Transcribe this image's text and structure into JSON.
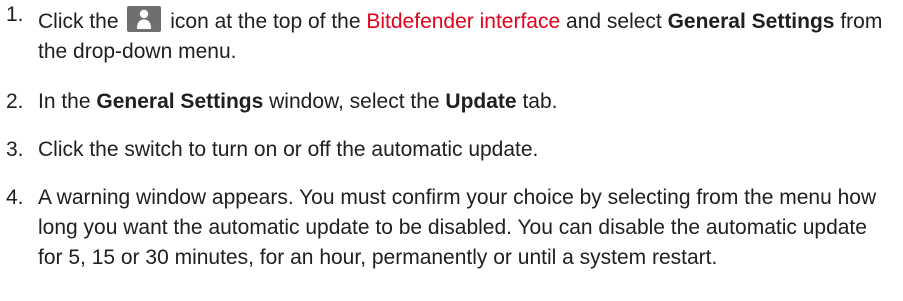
{
  "steps": [
    {
      "number": "1.",
      "text_before_icon": "Click the",
      "icon": "account-icon",
      "text_after_icon": "icon at the top of the",
      "link_text": "Bitdefender interface",
      "text_after_link": "and select",
      "bold_text": "General Settings",
      "text_end": "from the drop-down menu."
    },
    {
      "number": "2.",
      "text_before": "In the",
      "bold_1": "General Settings",
      "text_middle": "window, select the",
      "bold_2": "Update",
      "text_end": "tab."
    },
    {
      "number": "3.",
      "text": "Click the switch to turn on or off the automatic update."
    },
    {
      "number": "4.",
      "text": "A warning window appears. You must confirm your choice by selecting from the menu how long you want the automatic update to be disabled. You can disable the automatic update for 5, 15 or 30 minutes, for an hour, permanently or until a system restart."
    }
  ],
  "colors": {
    "link": "#e3001b",
    "text": "#202020",
    "icon_background": "#6f6f6f"
  }
}
